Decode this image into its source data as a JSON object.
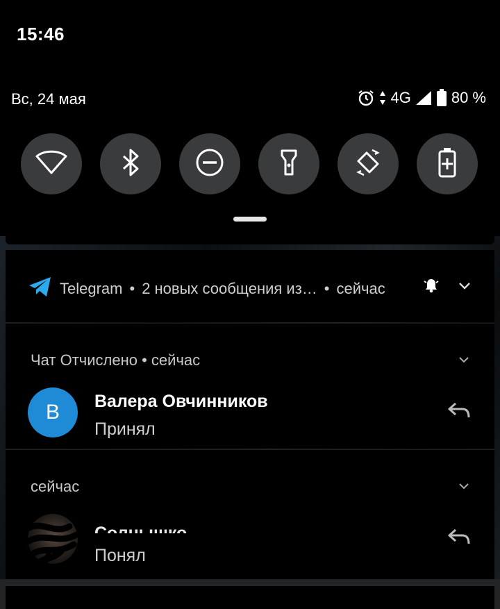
{
  "status_bar": {
    "time": "15:46"
  },
  "quick_settings": {
    "date": "Вс, 24 мая",
    "network": "4G",
    "battery": "80 %",
    "tiles": [
      {
        "icon": "wifi-icon",
        "label": "Wi-Fi"
      },
      {
        "icon": "bluetooth-icon",
        "label": "Bluetooth"
      },
      {
        "icon": "do-not-disturb-icon",
        "label": "Do not disturb"
      },
      {
        "icon": "flashlight-icon",
        "label": "Flashlight"
      },
      {
        "icon": "auto-rotate-icon",
        "label": "Auto-rotate"
      },
      {
        "icon": "battery-saver-icon",
        "label": "Battery saver"
      }
    ]
  },
  "notification_group": {
    "app": "Telegram",
    "summary": "2 новых сообщения из…",
    "time": "сейчас"
  },
  "notifications": [
    {
      "subtitle": "Чат Отчислено • сейчас",
      "avatar_letter": "В",
      "sender": "Валера Овчинников",
      "message": "Принял"
    },
    {
      "subtitle": "сейчас",
      "sender": "Солнышко",
      "message": "Понял"
    }
  ],
  "colors": {
    "telegram_blue": "#2AABEE",
    "avatar_blue": "#1F8AD6",
    "tile_bg": "#3A3B3C"
  }
}
